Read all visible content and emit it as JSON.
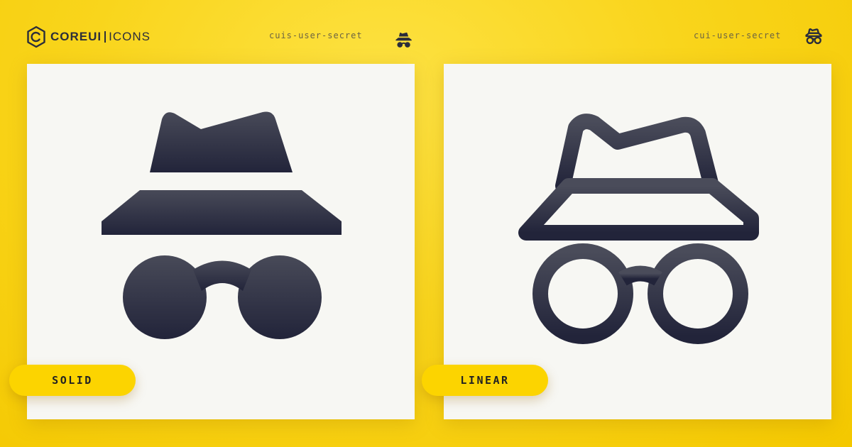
{
  "brand": {
    "core": "COREUI",
    "icons": "ICONS"
  },
  "colors": {
    "background": "#f9d51c",
    "panel": "#f7f7f3",
    "icon": "#2b2d3a",
    "badge": "#fcd400"
  },
  "left": {
    "icon_name": "cuis-user-secret",
    "variant": "SOLID",
    "icon": "user-secret-solid-icon"
  },
  "right": {
    "icon_name": "cui-user-secret",
    "variant": "LINEAR",
    "icon": "user-secret-linear-icon"
  }
}
